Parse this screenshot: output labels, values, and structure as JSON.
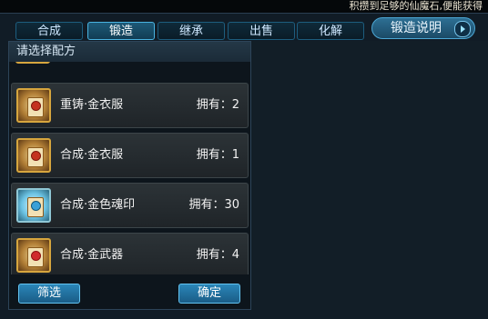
{
  "banner": {
    "text": "积攒到足够的仙魔石,便能获得"
  },
  "tabs": [
    {
      "label": "合成",
      "active": false
    },
    {
      "label": "锻造",
      "active": true
    },
    {
      "label": "继承",
      "active": false
    },
    {
      "label": "出售",
      "active": false
    },
    {
      "label": "化解",
      "active": false
    }
  ],
  "guide_button": {
    "label": "锻造说明",
    "icon": "arrow-right-icon"
  },
  "panel": {
    "title": "请选择配方"
  },
  "recipes": [
    {
      "name": "重铸·金衣服",
      "owned": "拥有：2",
      "icon": "scroll-icon",
      "icon_variant": "gold"
    },
    {
      "name": "合成·金衣服",
      "owned": "拥有：1",
      "icon": "scroll-icon",
      "icon_variant": "gold"
    },
    {
      "name": "合成·金色魂印",
      "owned": "拥有：30",
      "icon": "scroll-icon",
      "icon_variant": "blue"
    },
    {
      "name": "合成·金武器",
      "owned": "拥有：4",
      "icon": "scroll-icon",
      "icon_variant": "red"
    }
  ],
  "buttons": {
    "filter": "筛选",
    "confirm": "确定"
  }
}
